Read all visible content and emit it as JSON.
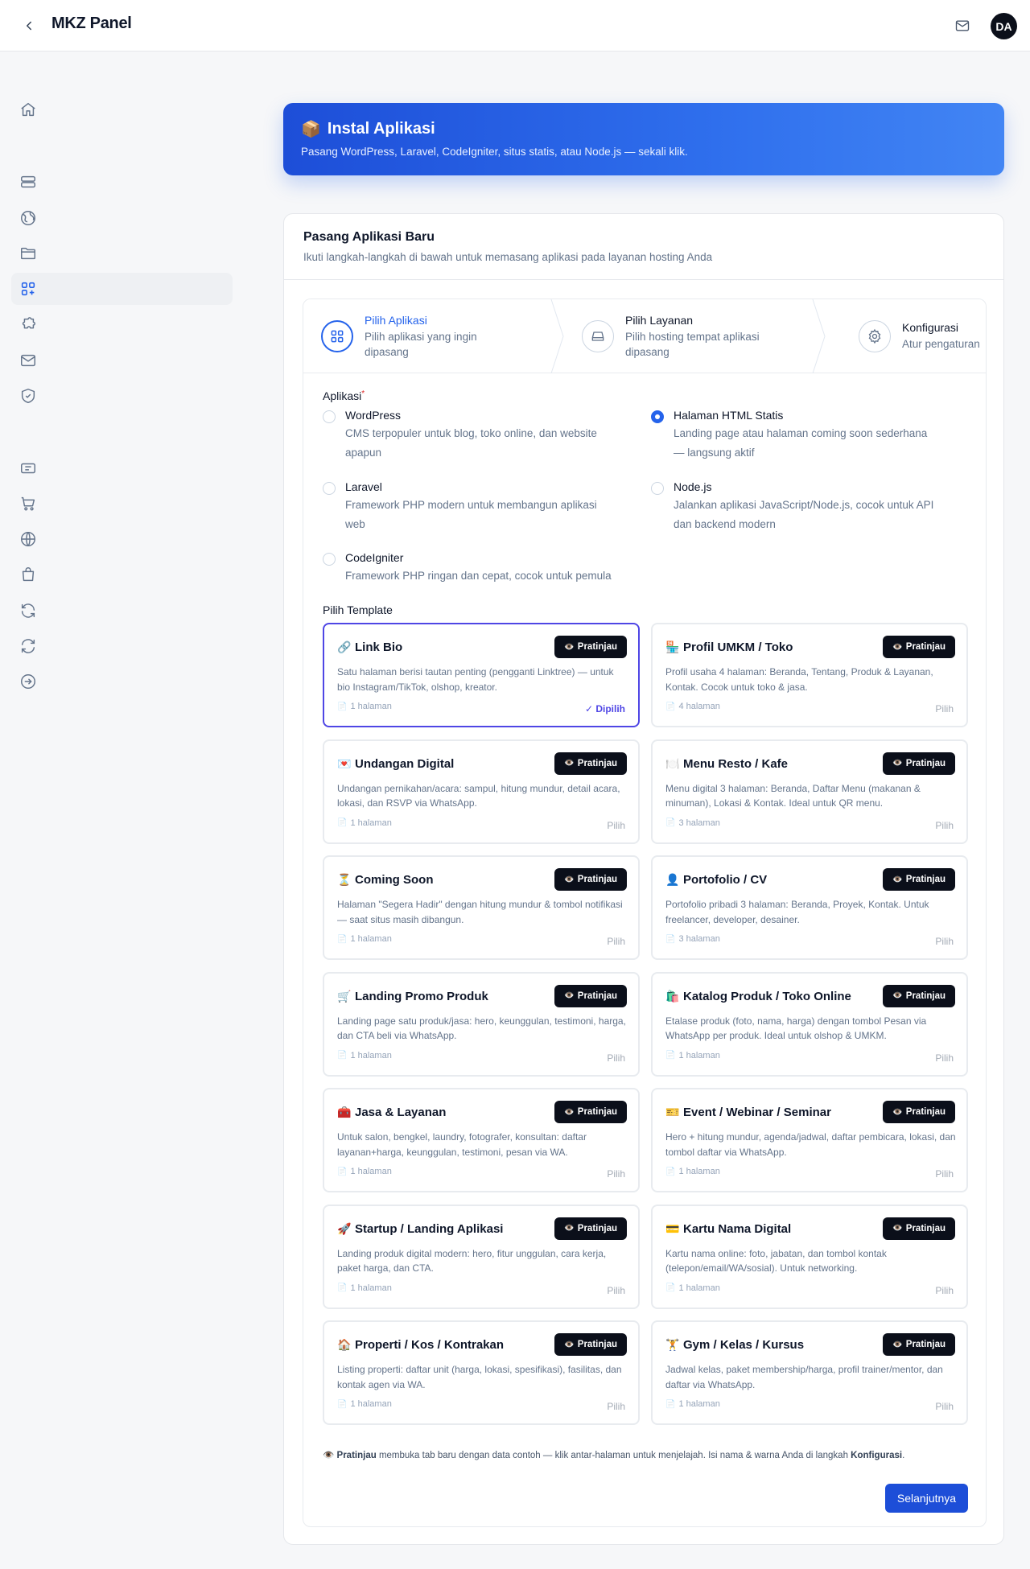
{
  "header": {
    "title": "MKZ Panel",
    "avatar_initials": "DA"
  },
  "sidebar": {
    "items": [
      {
        "icon": "home-icon"
      },
      {
        "icon": "server-icon"
      },
      {
        "icon": "globe-icon"
      },
      {
        "icon": "folder-icon"
      },
      {
        "icon": "apps-grid-icon"
      },
      {
        "icon": "puzzle-icon"
      },
      {
        "icon": "mail-icon"
      },
      {
        "icon": "shield-icon"
      },
      {
        "icon": "ticket-icon"
      },
      {
        "icon": "cart-icon"
      },
      {
        "icon": "world-icon"
      },
      {
        "icon": "bag-icon"
      },
      {
        "icon": "refresh-icon"
      },
      {
        "icon": "sync-icon"
      },
      {
        "icon": "arrow-circle-icon"
      }
    ],
    "active_index": 4
  },
  "hero": {
    "emoji": "📦",
    "title": "Instal Aplikasi",
    "subtitle": "Pasang WordPress, Laravel, CodeIgniter, situs statis, atau Node.js — sekali klik."
  },
  "card": {
    "title": "Pasang Aplikasi Baru",
    "subtitle": "Ikuti langkah-langkah di bawah untuk memasang aplikasi pada layanan hosting Anda"
  },
  "steps": [
    {
      "name": "Pilih Aplikasi",
      "desc": "Pilih aplikasi yang ingin dipasang"
    },
    {
      "name": "Pilih Layanan",
      "desc": "Pilih hosting tempat aplikasi dipasang"
    },
    {
      "name": "Konfigurasi",
      "desc": "Atur pengaturan"
    }
  ],
  "form": {
    "app_label": "Aplikasi",
    "required_mark": "*",
    "apps": [
      {
        "name": "WordPress",
        "desc": "CMS terpopuler untuk blog, toko online, dan website apapun",
        "checked": false
      },
      {
        "name": "Halaman HTML Statis",
        "desc": "Landing page atau halaman coming soon sederhana — langsung aktif",
        "checked": true
      },
      {
        "name": "Laravel",
        "desc": "Framework PHP modern untuk membangun aplikasi web",
        "checked": false
      },
      {
        "name": "Node.js",
        "desc": "Jalankan aplikasi JavaScript/Node.js, cocok untuk API dan backend modern",
        "checked": false
      },
      {
        "name": "CodeIgniter",
        "desc": "Framework PHP ringan dan cepat, cocok untuk pemula",
        "checked": false
      }
    ],
    "template_label": "Pilih Template",
    "preview_label": "Pratinjau",
    "preview_emoji": "👁️",
    "pages_emoji": "📄",
    "pick_label": "Pilih",
    "picked_label": "✓ Dipilih",
    "templates": [
      {
        "emoji": "🔗",
        "title": "Link Bio",
        "desc": "Satu halaman berisi tautan penting (pengganti Linktree) — untuk bio Instagram/TikTok, olshop, kreator.",
        "pages": "1 halaman",
        "selected": true
      },
      {
        "emoji": "🏪",
        "title": "Profil UMKM / Toko",
        "desc": "Profil usaha 4 halaman: Beranda, Tentang, Produk & Layanan, Kontak. Cocok untuk toko & jasa.",
        "pages": "4 halaman",
        "selected": false
      },
      {
        "emoji": "💌",
        "title": "Undangan Digital",
        "desc": "Undangan pernikahan/acara: sampul, hitung mundur, detail acara, lokasi, dan RSVP via WhatsApp.",
        "pages": "1 halaman",
        "selected": false
      },
      {
        "emoji": "🍽️",
        "title": "Menu Resto / Kafe",
        "desc": "Menu digital 3 halaman: Beranda, Daftar Menu (makanan & minuman), Lokasi & Kontak. Ideal untuk QR menu.",
        "pages": "3 halaman",
        "selected": false
      },
      {
        "emoji": "⏳",
        "title": "Coming Soon",
        "desc": "Halaman \"Segera Hadir\" dengan hitung mundur & tombol notifikasi — saat situs masih dibangun.",
        "pages": "1 halaman",
        "selected": false
      },
      {
        "emoji": "👤",
        "title": "Portofolio / CV",
        "desc": "Portofolio pribadi 3 halaman: Beranda, Proyek, Kontak. Untuk freelancer, developer, desainer.",
        "pages": "3 halaman",
        "selected": false
      },
      {
        "emoji": "🛒",
        "title": "Landing Promo Produk",
        "desc": "Landing page satu produk/jasa: hero, keunggulan, testimoni, harga, dan CTA beli via WhatsApp.",
        "pages": "1 halaman",
        "selected": false
      },
      {
        "emoji": "🛍️",
        "title": "Katalog Produk / Toko Online",
        "desc": "Etalase produk (foto, nama, harga) dengan tombol Pesan via WhatsApp per produk. Ideal untuk olshop & UMKM.",
        "pages": "1 halaman",
        "selected": false
      },
      {
        "emoji": "🧰",
        "title": "Jasa & Layanan",
        "desc": "Untuk salon, bengkel, laundry, fotografer, konsultan: daftar layanan+harga, keunggulan, testimoni, pesan via WA.",
        "pages": "1 halaman",
        "selected": false
      },
      {
        "emoji": "🎫",
        "title": "Event / Webinar / Seminar",
        "desc": "Hero + hitung mundur, agenda/jadwal, daftar pembicara, lokasi, dan tombol daftar via WhatsApp.",
        "pages": "1 halaman",
        "selected": false
      },
      {
        "emoji": "🚀",
        "title": "Startup / Landing Aplikasi",
        "desc": "Landing produk digital modern: hero, fitur unggulan, cara kerja, paket harga, dan CTA.",
        "pages": "1 halaman",
        "selected": false
      },
      {
        "emoji": "💳",
        "title": "Kartu Nama Digital",
        "desc": "Kartu nama online: foto, jabatan, dan tombol kontak (telepon/email/WA/sosial). Untuk networking.",
        "pages": "1 halaman",
        "selected": false
      },
      {
        "emoji": "🏠",
        "title": "Properti / Kos / Kontrakan",
        "desc": "Listing properti: daftar unit (harga, lokasi, spesifikasi), fasilitas, dan kontak agen via WA.",
        "pages": "1 halaman",
        "selected": false
      },
      {
        "emoji": "🏋️",
        "title": "Gym / Kelas / Kursus",
        "desc": "Jadwal kelas, paket membership/harga, profil trainer/mentor, dan daftar via WhatsApp.",
        "pages": "1 halaman",
        "selected": false
      }
    ],
    "note": {
      "emoji": "👁️",
      "bold1": "Pratinjau",
      "middle": " membuka tab baru dengan data contoh — klik antar-halaman untuk menjelajah. Isi nama & warna Anda di langkah ",
      "bold2": "Konfigurasi",
      "end": "."
    },
    "next_label": "Selanjutnya"
  },
  "colors": {
    "accent": "#2563eb",
    "selected_border": "#4f46e5",
    "dark_button": "#0b0f1a"
  }
}
